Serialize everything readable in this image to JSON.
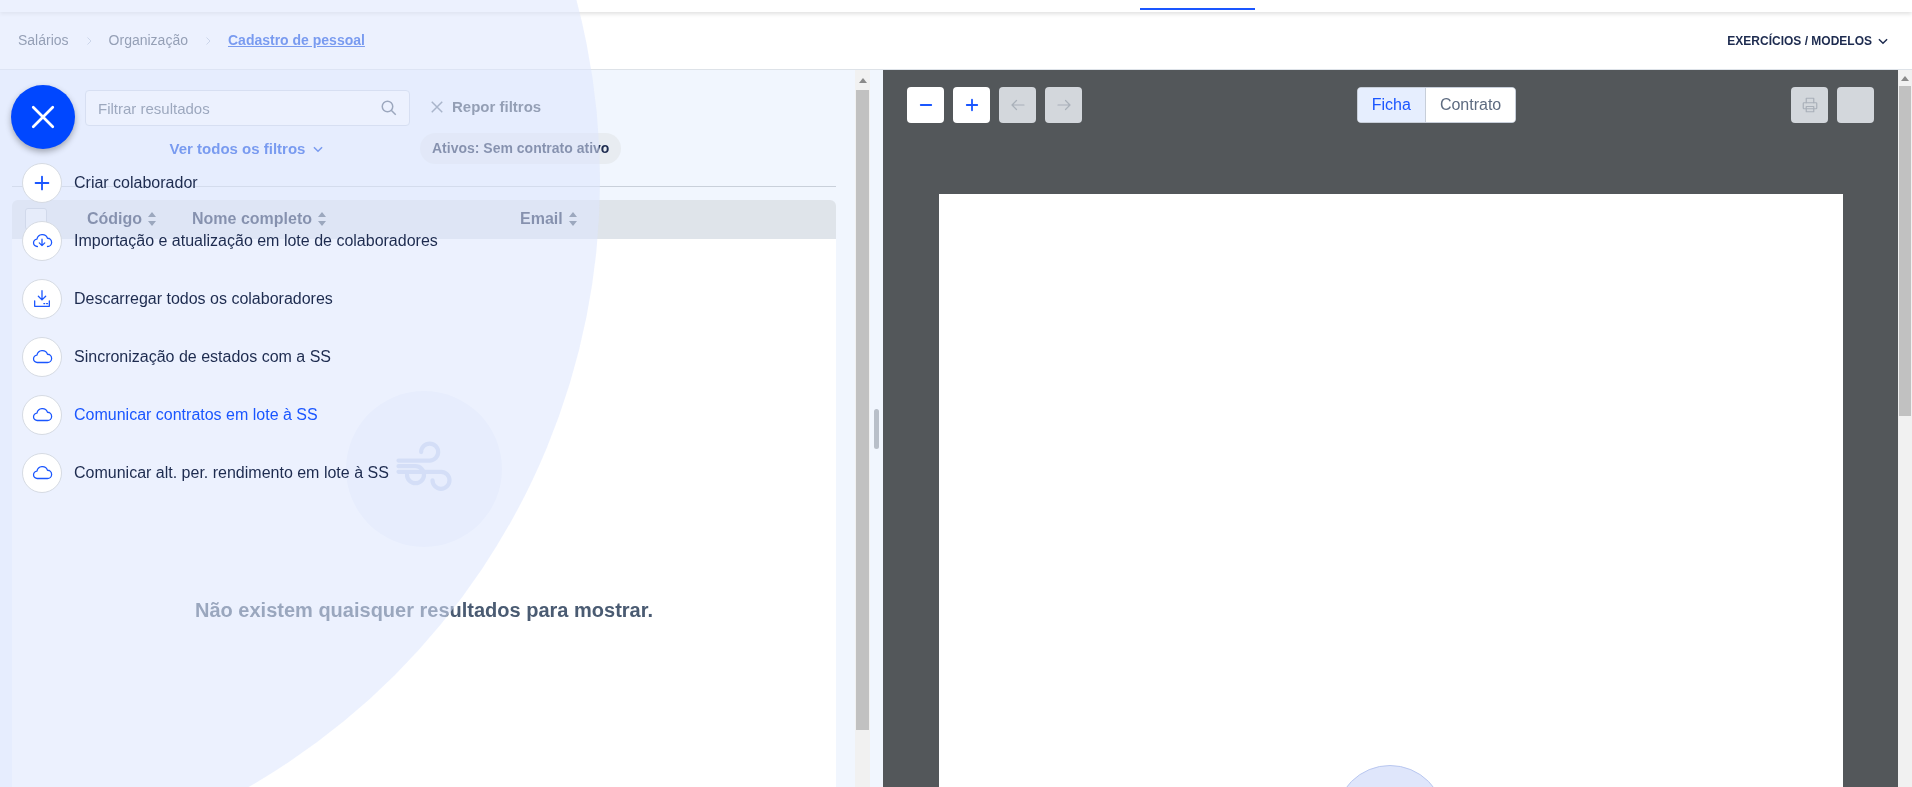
{
  "breadcrumb": [
    {
      "label": "Salários",
      "current": false
    },
    {
      "label": "Organização",
      "current": false
    },
    {
      "label": "Cadastro de pessoal",
      "current": true
    }
  ],
  "header_menu": {
    "label": "EXERCÍCIOS / MODELOS"
  },
  "filters": {
    "search_placeholder": "Filtrar resultados",
    "reset": "Repor filtros",
    "show_all": "Ver todos os filtros",
    "active_chip": "Ativos: Sem contrato ativo"
  },
  "table": {
    "select_all_checked": false,
    "columns": [
      {
        "label": "Código"
      },
      {
        "label": "Nome completo"
      },
      {
        "label": "Email"
      }
    ],
    "empty_message": "Não existem quaisquer resultados para mostrar."
  },
  "action_menu": {
    "items": [
      {
        "kind": "plus",
        "label": "Criar colaborador",
        "selected": false
      },
      {
        "kind": "import",
        "label": "Importação e atualização em lote de colaboradores",
        "selected": false
      },
      {
        "kind": "download",
        "label": "Descarregar todos os colaboradores",
        "selected": false
      },
      {
        "kind": "cloud",
        "label": "Sincronização de estados com a SS",
        "selected": false
      },
      {
        "kind": "cloud",
        "label": "Comunicar contratos em lote à SS",
        "selected": true
      },
      {
        "kind": "cloud",
        "label": "Comunicar alt. per. rendimento em lote à SS",
        "selected": false
      }
    ]
  },
  "viewer": {
    "toolbar": [
      {
        "kind": "zoom-out",
        "disabled": false
      },
      {
        "kind": "zoom-in",
        "disabled": false
      },
      {
        "kind": "back",
        "disabled": true
      },
      {
        "kind": "forward",
        "disabled": true
      }
    ],
    "tabs": [
      {
        "label": "Ficha",
        "selected": true
      },
      {
        "label": "Contrato",
        "selected": false
      }
    ],
    "actions": [
      {
        "kind": "print",
        "disabled": true
      },
      {
        "kind": "blank",
        "disabled": true
      }
    ]
  }
}
